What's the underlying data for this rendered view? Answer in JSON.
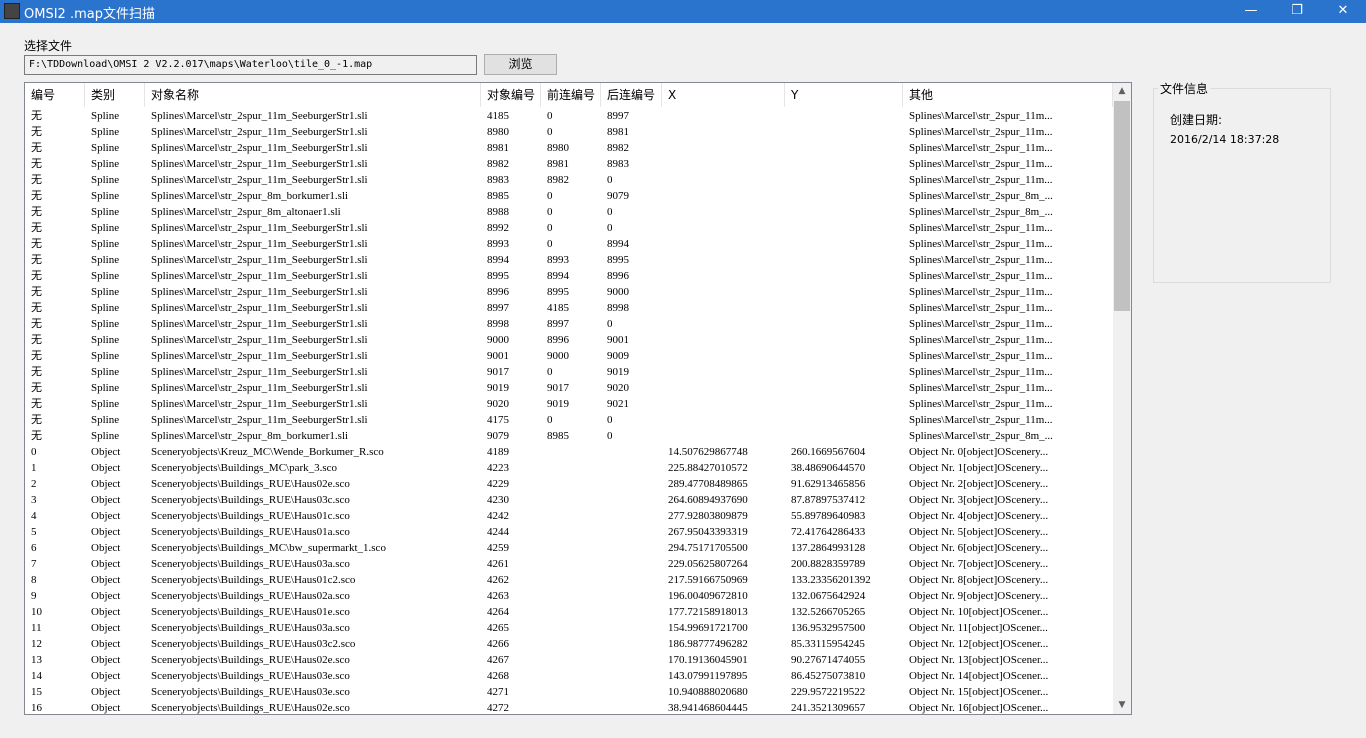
{
  "window": {
    "title": "OMSI2 .map文件扫描",
    "minimize": "—",
    "maximize": "❐",
    "close": "✕"
  },
  "file": {
    "label": "选择文件",
    "path": "F:\\TDDownload\\OMSI 2 V2.2.017\\maps\\Waterloo\\tile_0_-1.map",
    "browse": "浏览"
  },
  "table": {
    "columns": [
      "编号",
      "类别",
      "对象名称",
      "对象编号",
      "前连编号",
      "后连编号",
      "X",
      "Y",
      "其他"
    ],
    "rows": [
      [
        "无",
        "Spline",
        "Splines\\Marcel\\str_2spur_11m_SeeburgerStr1.sli",
        "4185",
        "0",
        "8997",
        "",
        "",
        "Splines\\Marcel\\str_2spur_11m..."
      ],
      [
        "无",
        "Spline",
        "Splines\\Marcel\\str_2spur_11m_SeeburgerStr1.sli",
        "8980",
        "0",
        "8981",
        "",
        "",
        "Splines\\Marcel\\str_2spur_11m..."
      ],
      [
        "无",
        "Spline",
        "Splines\\Marcel\\str_2spur_11m_SeeburgerStr1.sli",
        "8981",
        "8980",
        "8982",
        "",
        "",
        "Splines\\Marcel\\str_2spur_11m..."
      ],
      [
        "无",
        "Spline",
        "Splines\\Marcel\\str_2spur_11m_SeeburgerStr1.sli",
        "8982",
        "8981",
        "8983",
        "",
        "",
        "Splines\\Marcel\\str_2spur_11m..."
      ],
      [
        "无",
        "Spline",
        "Splines\\Marcel\\str_2spur_11m_SeeburgerStr1.sli",
        "8983",
        "8982",
        "0",
        "",
        "",
        "Splines\\Marcel\\str_2spur_11m..."
      ],
      [
        "无",
        "Spline",
        "Splines\\Marcel\\str_2spur_8m_borkumer1.sli",
        "8985",
        "0",
        "9079",
        "",
        "",
        "Splines\\Marcel\\str_2spur_8m_..."
      ],
      [
        "无",
        "Spline",
        "Splines\\Marcel\\str_2spur_8m_altonaer1.sli",
        "8988",
        "0",
        "0",
        "",
        "",
        "Splines\\Marcel\\str_2spur_8m_..."
      ],
      [
        "无",
        "Spline",
        "Splines\\Marcel\\str_2spur_11m_SeeburgerStr1.sli",
        "8992",
        "0",
        "0",
        "",
        "",
        "Splines\\Marcel\\str_2spur_11m..."
      ],
      [
        "无",
        "Spline",
        "Splines\\Marcel\\str_2spur_11m_SeeburgerStr1.sli",
        "8993",
        "0",
        "8994",
        "",
        "",
        "Splines\\Marcel\\str_2spur_11m..."
      ],
      [
        "无",
        "Spline",
        "Splines\\Marcel\\str_2spur_11m_SeeburgerStr1.sli",
        "8994",
        "8993",
        "8995",
        "",
        "",
        "Splines\\Marcel\\str_2spur_11m..."
      ],
      [
        "无",
        "Spline",
        "Splines\\Marcel\\str_2spur_11m_SeeburgerStr1.sli",
        "8995",
        "8994",
        "8996",
        "",
        "",
        "Splines\\Marcel\\str_2spur_11m..."
      ],
      [
        "无",
        "Spline",
        "Splines\\Marcel\\str_2spur_11m_SeeburgerStr1.sli",
        "8996",
        "8995",
        "9000",
        "",
        "",
        "Splines\\Marcel\\str_2spur_11m..."
      ],
      [
        "无",
        "Spline",
        "Splines\\Marcel\\str_2spur_11m_SeeburgerStr1.sli",
        "8997",
        "4185",
        "8998",
        "",
        "",
        "Splines\\Marcel\\str_2spur_11m..."
      ],
      [
        "无",
        "Spline",
        "Splines\\Marcel\\str_2spur_11m_SeeburgerStr1.sli",
        "8998",
        "8997",
        "0",
        "",
        "",
        "Splines\\Marcel\\str_2spur_11m..."
      ],
      [
        "无",
        "Spline",
        "Splines\\Marcel\\str_2spur_11m_SeeburgerStr1.sli",
        "9000",
        "8996",
        "9001",
        "",
        "",
        "Splines\\Marcel\\str_2spur_11m..."
      ],
      [
        "无",
        "Spline",
        "Splines\\Marcel\\str_2spur_11m_SeeburgerStr1.sli",
        "9001",
        "9000",
        "9009",
        "",
        "",
        "Splines\\Marcel\\str_2spur_11m..."
      ],
      [
        "无",
        "Spline",
        "Splines\\Marcel\\str_2spur_11m_SeeburgerStr1.sli",
        "9017",
        "0",
        "9019",
        "",
        "",
        "Splines\\Marcel\\str_2spur_11m..."
      ],
      [
        "无",
        "Spline",
        "Splines\\Marcel\\str_2spur_11m_SeeburgerStr1.sli",
        "9019",
        "9017",
        "9020",
        "",
        "",
        "Splines\\Marcel\\str_2spur_11m..."
      ],
      [
        "无",
        "Spline",
        "Splines\\Marcel\\str_2spur_11m_SeeburgerStr1.sli",
        "9020",
        "9019",
        "9021",
        "",
        "",
        "Splines\\Marcel\\str_2spur_11m..."
      ],
      [
        "无",
        "Spline",
        "Splines\\Marcel\\str_2spur_11m_SeeburgerStr1.sli",
        "4175",
        "0",
        "0",
        "",
        "",
        "Splines\\Marcel\\str_2spur_11m..."
      ],
      [
        "无",
        "Spline",
        "Splines\\Marcel\\str_2spur_8m_borkumer1.sli",
        "9079",
        "8985",
        "0",
        "",
        "",
        "Splines\\Marcel\\str_2spur_8m_..."
      ],
      [
        "0",
        "Object",
        "Sceneryobjects\\Kreuz_MC\\Wende_Borkumer_R.sco",
        "4189",
        "",
        "",
        "14.507629867748",
        "260.1669567604",
        "Object Nr. 0[object]OScenery..."
      ],
      [
        "1",
        "Object",
        "Sceneryobjects\\Buildings_MC\\park_3.sco",
        "4223",
        "",
        "",
        "225.88427010572",
        "38.48690644570",
        "Object Nr. 1[object]OScenery..."
      ],
      [
        "2",
        "Object",
        "Sceneryobjects\\Buildings_RUE\\Haus02e.sco",
        "4229",
        "",
        "",
        "289.47708489865",
        "91.62913465856",
        "Object Nr. 2[object]OScenery..."
      ],
      [
        "3",
        "Object",
        "Sceneryobjects\\Buildings_RUE\\Haus03c.sco",
        "4230",
        "",
        "",
        "264.60894937690",
        "87.87897537412",
        "Object Nr. 3[object]OScenery..."
      ],
      [
        "4",
        "Object",
        "Sceneryobjects\\Buildings_RUE\\Haus01c.sco",
        "4242",
        "",
        "",
        "277.92803809879",
        "55.89789640983",
        "Object Nr. 4[object]OScenery..."
      ],
      [
        "5",
        "Object",
        "Sceneryobjects\\Buildings_RUE\\Haus01a.sco",
        "4244",
        "",
        "",
        "267.95043393319",
        "72.41764286433",
        "Object Nr. 5[object]OScenery..."
      ],
      [
        "6",
        "Object",
        "Sceneryobjects\\Buildings_MC\\bw_supermarkt_1.sco",
        "4259",
        "",
        "",
        "294.75171705500",
        "137.2864993128",
        "Object Nr. 6[object]OScenery..."
      ],
      [
        "7",
        "Object",
        "Sceneryobjects\\Buildings_RUE\\Haus03a.sco",
        "4261",
        "",
        "",
        "229.05625807264",
        "200.8828359789",
        "Object Nr. 7[object]OScenery..."
      ],
      [
        "8",
        "Object",
        "Sceneryobjects\\Buildings_RUE\\Haus01c2.sco",
        "4262",
        "",
        "",
        "217.59166750969",
        "133.23356201392",
        "Object Nr. 8[object]OScenery..."
      ],
      [
        "9",
        "Object",
        "Sceneryobjects\\Buildings_RUE\\Haus02a.sco",
        "4263",
        "",
        "",
        "196.00409672810",
        "132.0675642924",
        "Object Nr. 9[object]OScenery..."
      ],
      [
        "10",
        "Object",
        "Sceneryobjects\\Buildings_RUE\\Haus01e.sco",
        "4264",
        "",
        "",
        "177.72158918013",
        "132.5266705265",
        "Object Nr. 10[object]OScener..."
      ],
      [
        "11",
        "Object",
        "Sceneryobjects\\Buildings_RUE\\Haus03a.sco",
        "4265",
        "",
        "",
        "154.99691721700",
        "136.9532957500",
        "Object Nr. 11[object]OScener..."
      ],
      [
        "12",
        "Object",
        "Sceneryobjects\\Buildings_RUE\\Haus03c2.sco",
        "4266",
        "",
        "",
        "186.98777496282",
        "85.33115954245",
        "Object Nr. 12[object]OScener..."
      ],
      [
        "13",
        "Object",
        "Sceneryobjects\\Buildings_RUE\\Haus02e.sco",
        "4267",
        "",
        "",
        "170.19136045901",
        "90.27671474055",
        "Object Nr. 13[object]OScener..."
      ],
      [
        "14",
        "Object",
        "Sceneryobjects\\Buildings_RUE\\Haus03e.sco",
        "4268",
        "",
        "",
        "143.07991197895",
        "86.45275073810",
        "Object Nr. 14[object]OScener..."
      ],
      [
        "15",
        "Object",
        "Sceneryobjects\\Buildings_RUE\\Haus03e.sco",
        "4271",
        "",
        "",
        "10.940888020680",
        "229.9572219522",
        "Object Nr. 15[object]OScener..."
      ],
      [
        "16",
        "Object",
        "Sceneryobjects\\Buildings_RUE\\Haus02e.sco",
        "4272",
        "",
        "",
        "38.941468604445",
        "241.3521309657",
        "Object Nr. 16[object]OScener..."
      ]
    ]
  },
  "info": {
    "title": "文件信息",
    "created_label": "创建日期:",
    "created_value": "2016/2/14 18:37:28"
  },
  "scrollbar": {
    "up": "▲",
    "down": "▼"
  }
}
